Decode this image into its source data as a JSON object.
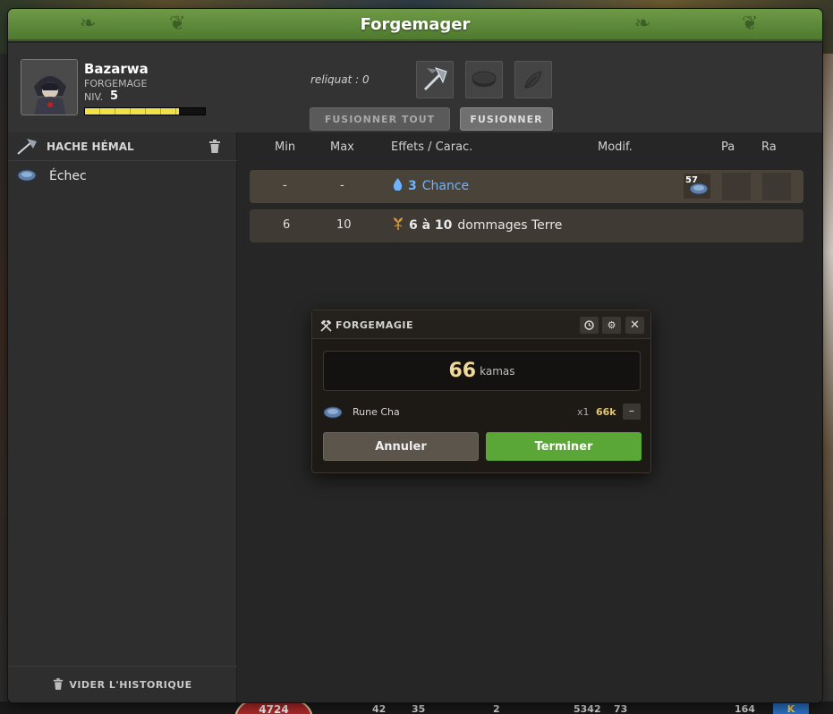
{
  "window": {
    "title": "Forgemager"
  },
  "character": {
    "name": "Bazarwa",
    "class": "FORGEMAGE",
    "level_label": "NIV.",
    "level": "5",
    "xp_fraction": 0.78
  },
  "forge": {
    "reliquat": "reliquat : 0",
    "slots": [
      "axe-item-slot",
      "rune-slot",
      "feather-slot"
    ],
    "buttons": {
      "fusion_all": "FUSIONNER TOUT",
      "fusion": "FUSIONNER"
    }
  },
  "sidebar": {
    "item_name": "HACHE HÉMAL",
    "history": [
      {
        "text": "Échec"
      }
    ],
    "clear_history": "VIDER L'HISTORIQUE"
  },
  "table": {
    "headers": {
      "min": "Min",
      "max": "Max",
      "effects": "Effets / Carac.",
      "modif": "Modif.",
      "pa": "Pa",
      "ra": "Ra"
    },
    "rows": [
      {
        "min": "-",
        "max": "-",
        "effect_value": "3",
        "effect_text": "Chance",
        "modif_count": "57"
      },
      {
        "min": "6",
        "max": "10",
        "effect_value": "6 à 10",
        "effect_text": "dommages Terre"
      }
    ]
  },
  "modal": {
    "title": "FORGEMAGIE",
    "price_value": "66",
    "price_unit": "kamas",
    "rune": {
      "name": "Rune Cha",
      "qty": "x1",
      "price": "66k",
      "minus": "–"
    },
    "cancel": "Annuler",
    "finish": "Terminer"
  },
  "hud": {
    "life": "4724",
    "values": [
      "42",
      "35",
      "2",
      "5342",
      "73",
      "164"
    ],
    "k_label": "K"
  },
  "colors": {
    "title_green": "#5a8a38",
    "finish_green": "#5aa636",
    "chance_blue": "#6fb3ff",
    "price_gold": "#f0d898"
  }
}
